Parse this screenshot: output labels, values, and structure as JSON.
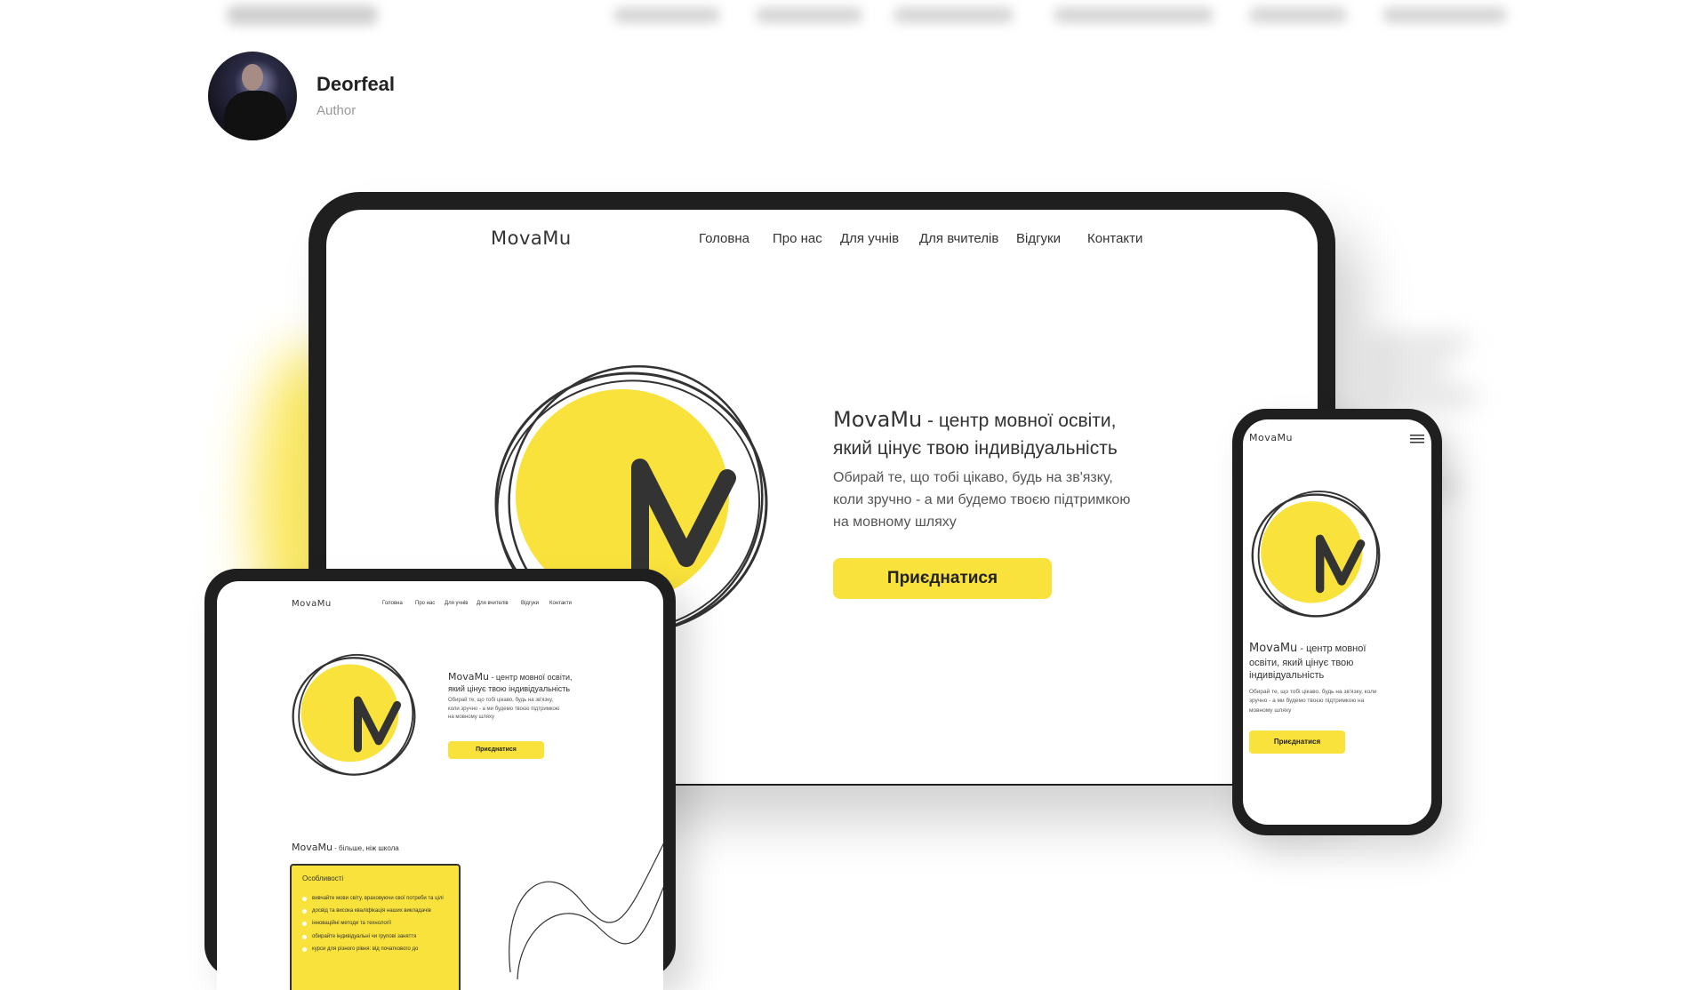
{
  "author": {
    "name": "Deorfeal",
    "role": "Author"
  },
  "site": {
    "logo": "MovaMu",
    "nav": [
      "Головна",
      "Про нас",
      "Для учнів",
      "Для вчителів",
      "Відгуки",
      "Контакти"
    ],
    "hero": {
      "brand": "MovaMu",
      "title_rest_line1": " - центр мовної освіти,",
      "title_line2": "який цінує твою індивідуальність",
      "text_lines": [
        "Обирай те, що тобі цікаво, будь на зв'язку,",
        "коли зручно - а ми будемо твоєю підтримкою",
        "на мовному шляху"
      ],
      "cta": "Приєднатися"
    },
    "section2": {
      "brand": "MovaMu",
      "title_rest": " - більше, ніж школа",
      "card_title": "Особливості",
      "features": [
        "вивчайте мови світу, враховуючи свої потреби та цілі",
        "досвід та висока кваліфікація наших викладачів",
        "інноваційні методи та технології",
        "обирайте індивідуальні чи групові заняття",
        "курси для різного рівня: від початкового до"
      ]
    },
    "phone_hero": {
      "title_line1": " - центр мовної",
      "title_line2": "освіти, який цінує твою",
      "title_line3": "індивідуальність",
      "text_lines": [
        "Обирай те, що тобі цікаво, будь на зв'язку, коли",
        "зручно - а ми будемо твоєю підтримкою на",
        "мовному шляху"
      ]
    }
  },
  "colors": {
    "accent": "#f9e23b",
    "device": "#1f1f1f",
    "text": "#333333"
  },
  "icons": {
    "menu": "hamburger-menu-icon"
  }
}
